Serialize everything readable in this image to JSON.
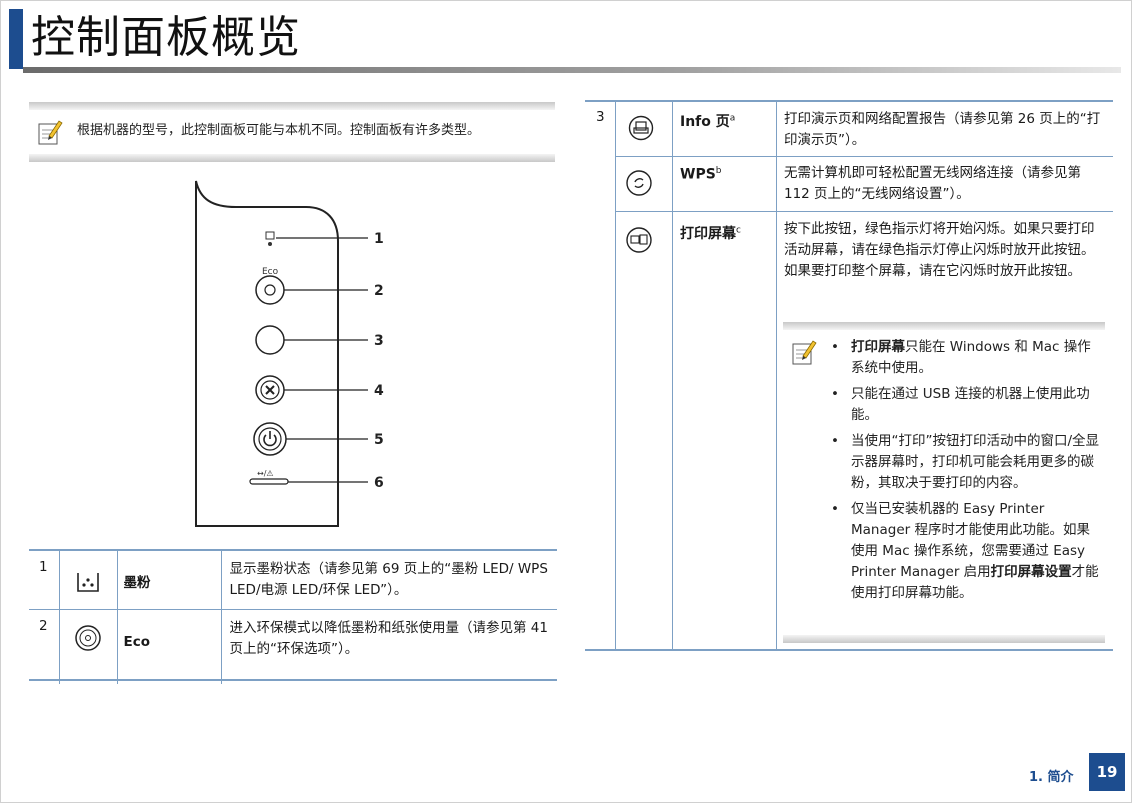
{
  "header": {
    "title": "控制面板概览"
  },
  "left_note": {
    "text": "根据机器的型号，此控制面板可能与本机不同。控制面板有许多类型。"
  },
  "panel": {
    "callouts": [
      "1",
      "2",
      "3",
      "4",
      "5",
      "6"
    ],
    "eco_label": "Eco"
  },
  "left_table": {
    "rows": [
      {
        "num": "1",
        "icon": "toner-icon",
        "name": "墨粉",
        "desc": "显示墨粉状态（请参见第 69 页上的“墨粉 LED/ WPS LED/电源 LED/环保 LED”）。"
      },
      {
        "num": "2",
        "icon": "eco-icon",
        "name": "Eco",
        "desc": "进入环保模式以降低墨粉和纸张使用量（请参见第 41 页上的“环保选项”）。"
      }
    ]
  },
  "right_table": {
    "num": "3",
    "rows": [
      {
        "icon": "info-page-icon",
        "name": "Info 页",
        "sup": "a",
        "desc": "打印演示页和网络配置报告（请参见第 26 页上的“打印演示页”）。"
      },
      {
        "icon": "wps-icon",
        "name": "WPS",
        "sup": "b",
        "desc": "无需计算机即可轻松配置无线网络连接（请参见第 112 页上的“无线网络设置”）。"
      },
      {
        "icon": "print-screen-icon",
        "name": "打印屏幕",
        "sup": "c",
        "desc": "按下此按钮，绿色指示灯将开始闪烁。如果只要打印活动屏幕，请在绿色指示灯停止闪烁时放开此按钮。如果要打印整个屏幕，请在它闪烁时放开此按钮。"
      }
    ]
  },
  "right_note": {
    "b1_bold": "打印屏幕",
    "b1_rest": "只能在 Windows 和 Mac 操作系统中使用。",
    "b2": "只能在通过 USB 连接的机器上使用此功能。",
    "b3": "当使用“打印”按钮打印活动中的窗口/全显示器屏幕时，打印机可能会耗用更多的碳粉，其取决于要打印的内容。",
    "b4_a": "仅当已安装机器的 Easy Printer Manager 程序时才能使用此功能。如果使用 Mac 操作系统，您需要通过 Easy Printer Manager 启用",
    "b4_bold": "打印屏幕设置",
    "b4_c": "才能使用打印屏幕功能。"
  },
  "footer": {
    "section": "1. 简介",
    "page": "19"
  },
  "colors": {
    "accent": "#1d4d8f",
    "rule": "#7da0c4"
  }
}
